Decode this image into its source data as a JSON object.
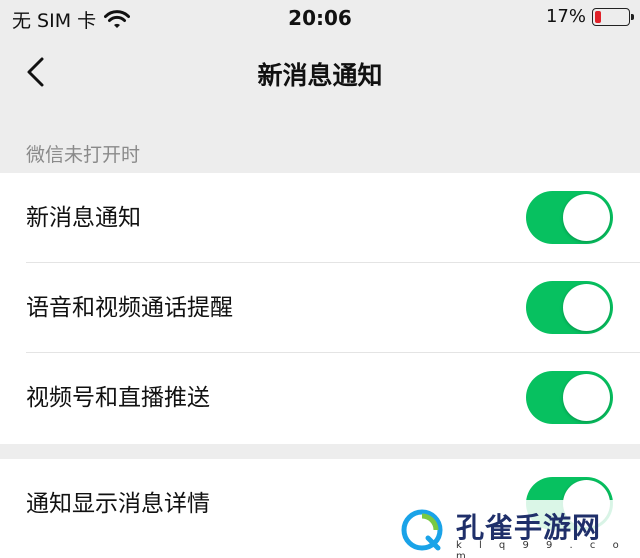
{
  "status_bar": {
    "carrier": "无 SIM 卡",
    "time": "20:06",
    "battery_text": "17%",
    "battery_level": 0.17,
    "battery_color": "#e0222a"
  },
  "nav": {
    "title": "新消息通知"
  },
  "section": {
    "label": "微信未打开时"
  },
  "rows": [
    {
      "label": "新消息通知",
      "enabled": true
    },
    {
      "label": "语音和视频通话提醒",
      "enabled": true
    },
    {
      "label": "视频号和直播推送",
      "enabled": true
    },
    {
      "label": "通知显示消息详情",
      "enabled": true
    }
  ],
  "accent_color": "#07c160",
  "watermark": {
    "title": "孔雀手游网",
    "subtitle": "k l q 9 9 . c o m"
  }
}
